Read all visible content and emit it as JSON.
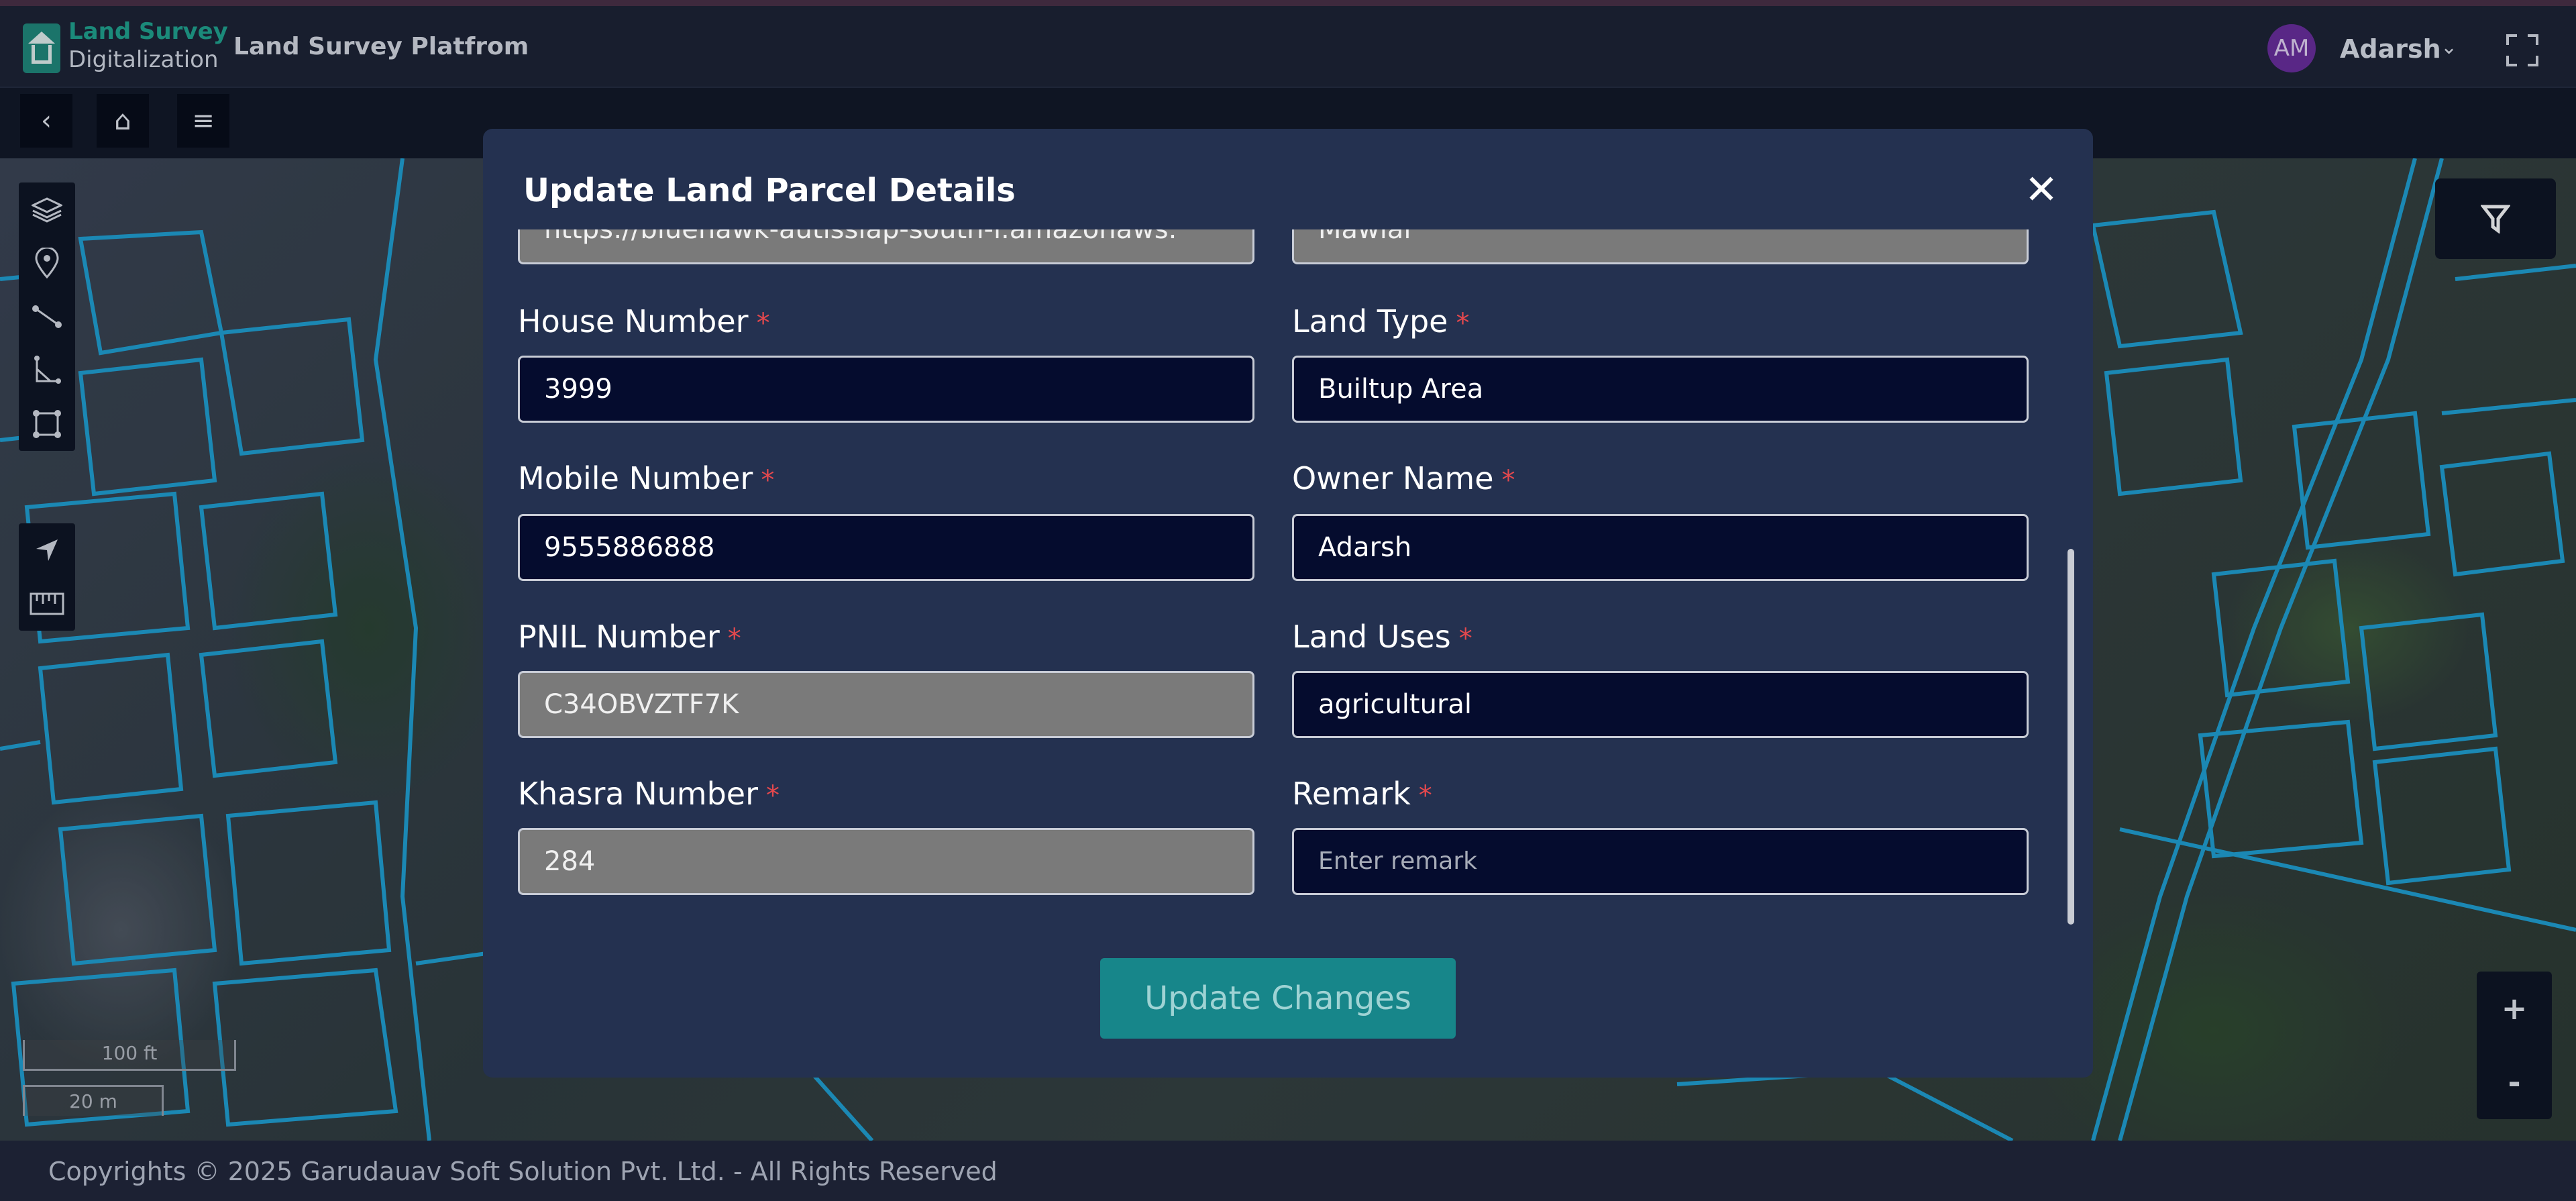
{
  "header": {
    "brand_line1": "Land Survey",
    "brand_line2": "Digitalization",
    "platform_title": "Land Survey Platfrom",
    "avatar_initials": "AM",
    "user_name": "Adarsh",
    "user_chevron": "⌄"
  },
  "subnav": {
    "back_icon": "‹",
    "home_icon": "⌂",
    "menu_icon": "≡"
  },
  "map": {
    "scale_feet": "100 ft",
    "scale_meters": "20 m",
    "zoom_in": "+",
    "zoom_out": "-"
  },
  "modal": {
    "title": "Update Land Parcel Details",
    "close_label": "✕",
    "partial_left_value": "https://bluehawk-autissiap-south-i.amazonaws.",
    "partial_right_value": "Mawlai",
    "required_mark": "*",
    "fields": [
      {
        "label": "House Number",
        "value": "3999",
        "placeholder": ""
      },
      {
        "label": "Land Type",
        "value": "Builtup Area",
        "placeholder": ""
      },
      {
        "label": "Mobile Number",
        "value": "9555886888",
        "placeholder": ""
      },
      {
        "label": "Owner Name",
        "value": "Adarsh",
        "placeholder": ""
      },
      {
        "label": "PNIL Number",
        "value": "C34OBVZTF7K",
        "placeholder": ""
      },
      {
        "label": "Land Uses",
        "value": "agricultural",
        "placeholder": ""
      },
      {
        "label": "Khasra Number",
        "value": "284",
        "placeholder": ""
      },
      {
        "label": "Remark",
        "value": "",
        "placeholder": "Enter remark"
      }
    ],
    "submit_label": "Update Changes"
  },
  "footer": {
    "copyright": "Copyrights © 2025 Garudauav Soft Solution Pvt. Ltd. - All Rights Reserved"
  },
  "colors": {
    "modal_bg": "#243150",
    "input_dark": "#050c2e",
    "input_disabled": "#7a7a7a",
    "accent_teal": "#17868a",
    "required_red": "#e5484d",
    "parcel_outline": "#1fa3d6"
  }
}
